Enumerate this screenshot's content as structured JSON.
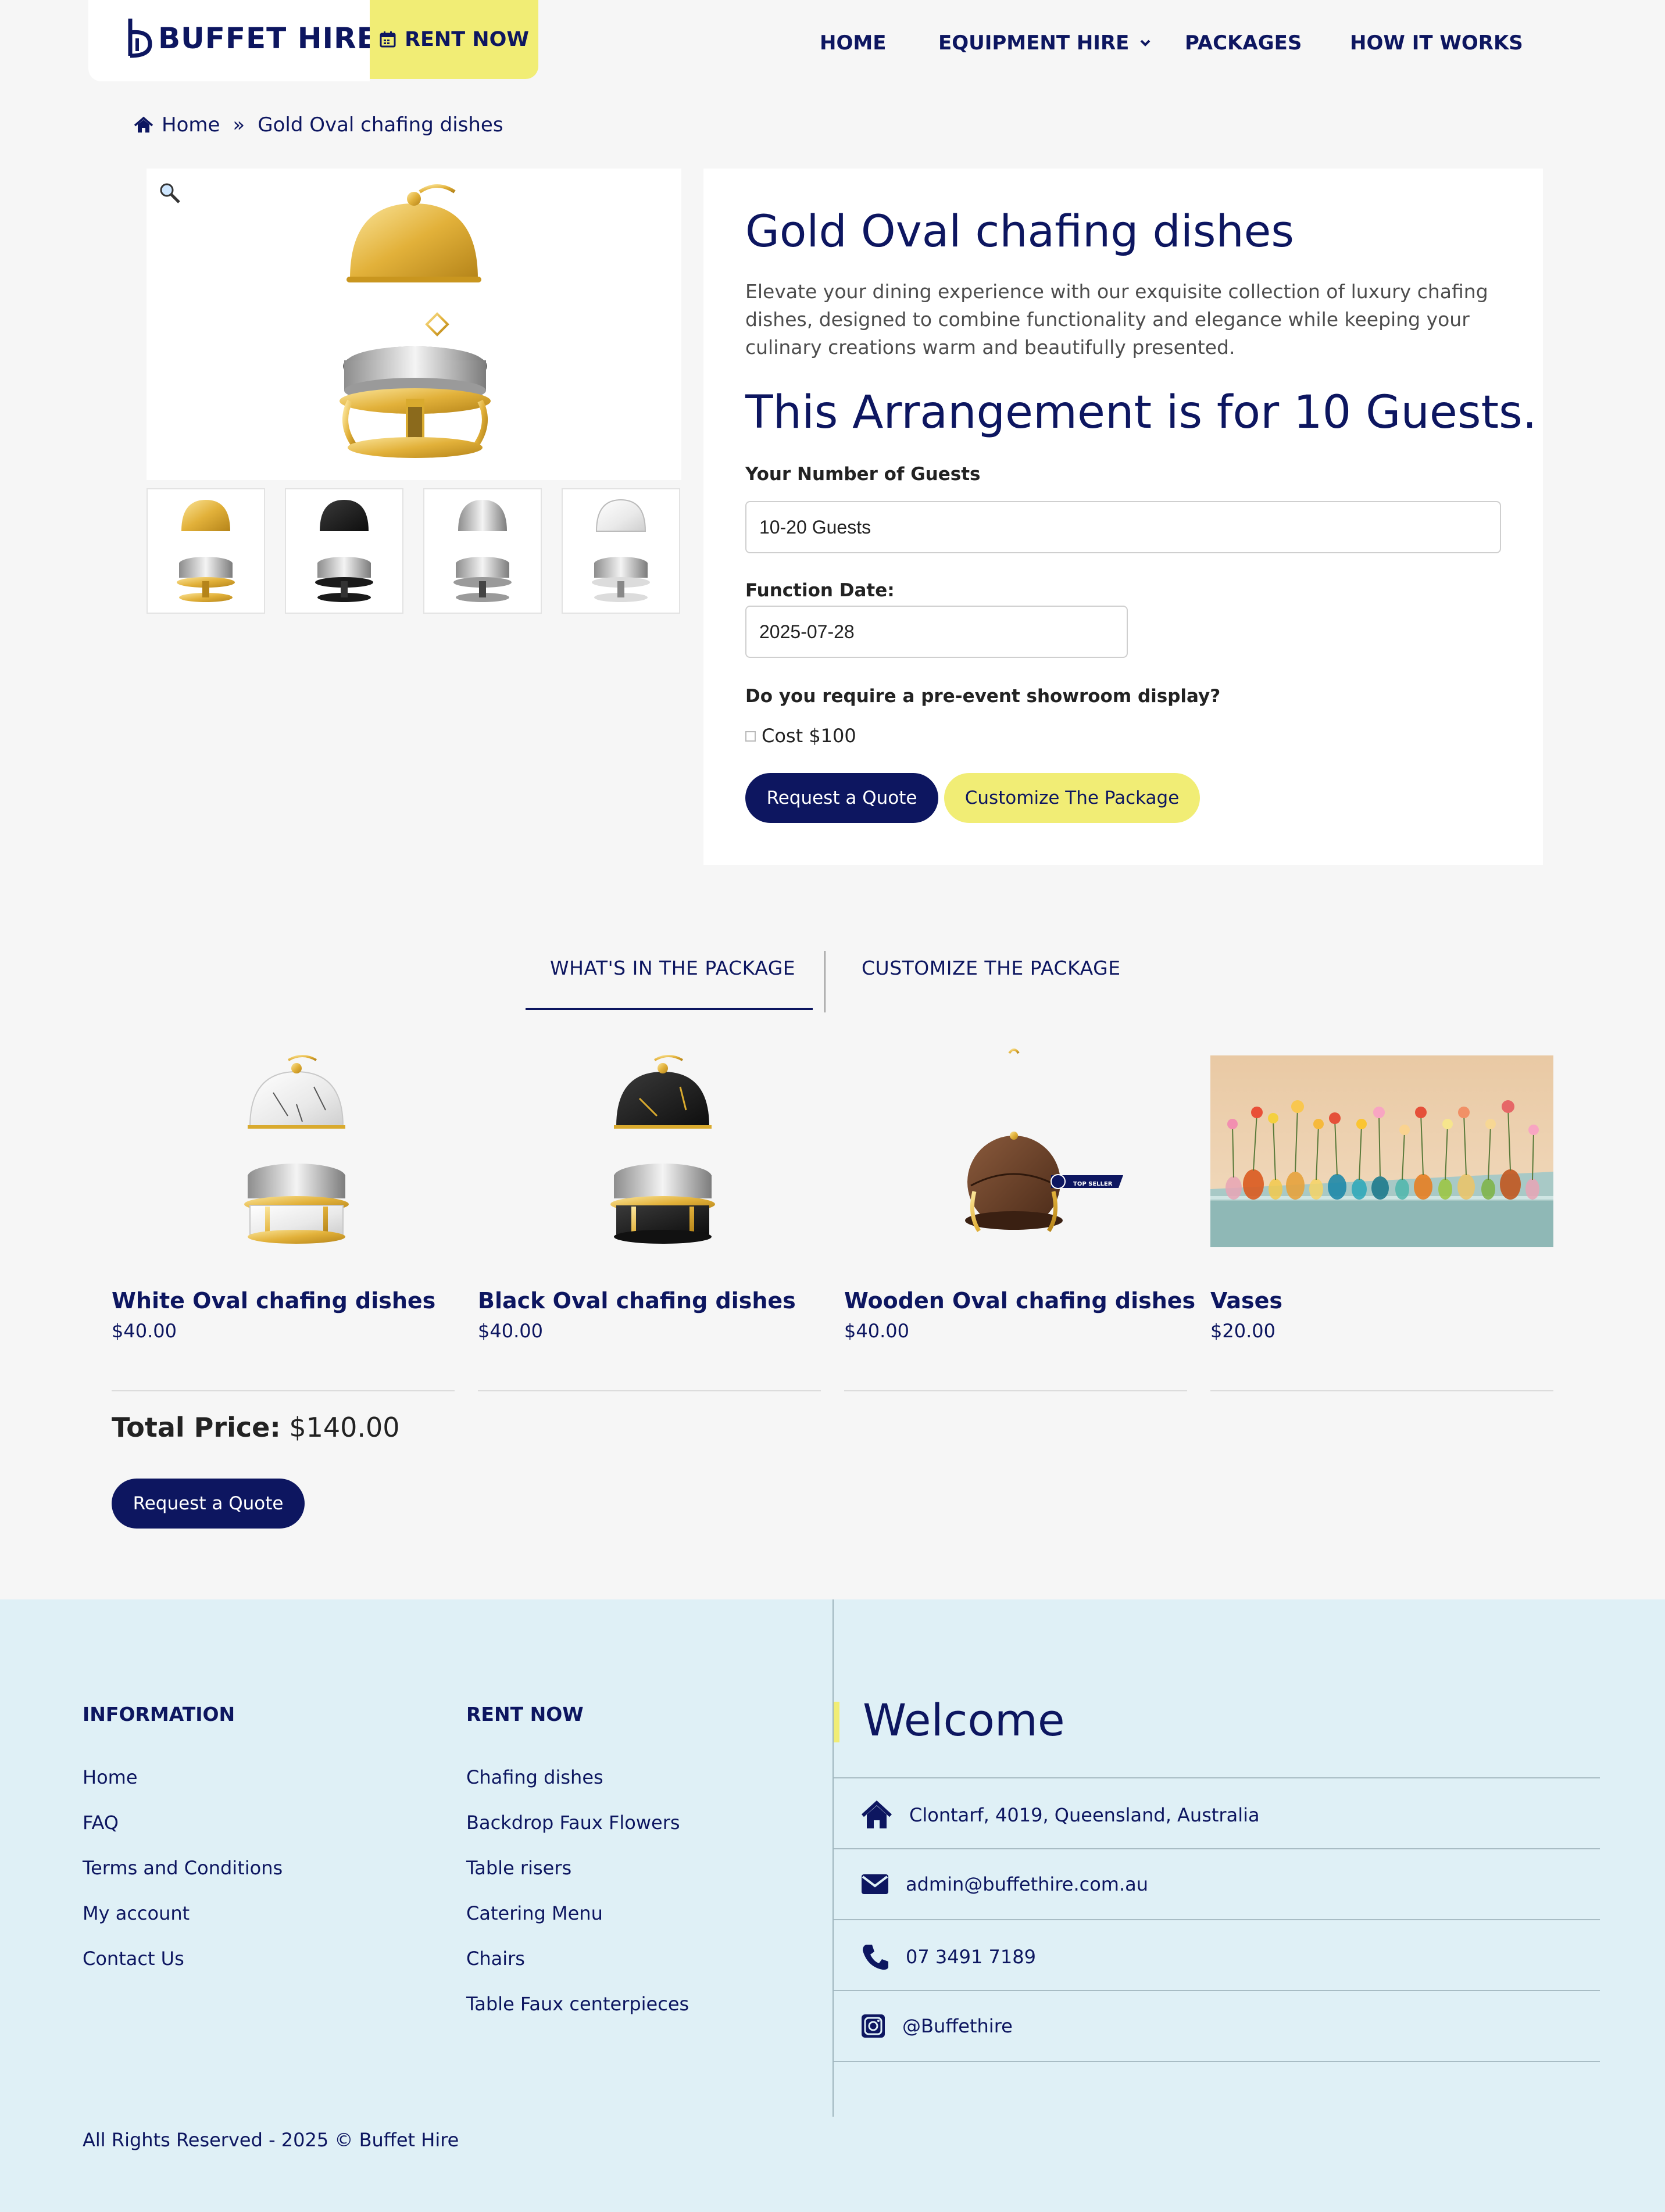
{
  "header": {
    "logo_text": "BUFFET HIRE",
    "rent_now_label": "RENT NOW",
    "nav": [
      "HOME",
      "EQUIPMENT HIRE",
      "PACKAGES",
      "HOW IT WORKS"
    ]
  },
  "breadcrumb": {
    "home": "Home",
    "separator": "»",
    "current": "Gold Oval chafing dishes"
  },
  "product": {
    "title": "Gold Oval chafing dishes",
    "description": "Elevate your dining experience with our exquisite collection of luxury chafing dishes, designed to combine functionality and elegance while keeping your culinary creations warm and beautifully presented.",
    "arrangement_heading": "This Arrangement is for 10 Guests.",
    "guests_label": "Your Number of Guests",
    "guests_value": "10-20 Guests",
    "date_label": "Function Date:",
    "date_value": "2025-07-28",
    "showroom_label": "Do you require a pre-event showroom display?",
    "showroom_cost": "Cost $100",
    "request_quote": "Request a Quote",
    "customize": "Customize The Package"
  },
  "tabs": [
    "WHAT'S IN THE PACKAGE",
    "CUSTOMIZE THE PACKAGE"
  ],
  "package_items": [
    {
      "name": "White Oval chafing dishes",
      "price": "$40.00"
    },
    {
      "name": "Black Oval chafing dishes",
      "price": "$40.00"
    },
    {
      "name": "Wooden Oval chafing dishes",
      "price": "$40.00"
    },
    {
      "name": "Vases",
      "price": "$20.00"
    }
  ],
  "top_seller_badge": "TOP SELLER",
  "total": {
    "label": "Total Price:",
    "value": "$140.00"
  },
  "bottom_request_quote": "Request a Quote",
  "footer": {
    "information_heading": "INFORMATION",
    "information_links": [
      "Home",
      "FAQ",
      "Terms and Conditions",
      "My account",
      "Contact Us"
    ],
    "rent_heading": "RENT NOW",
    "rent_links": [
      "Chafing dishes",
      "Backdrop Faux Flowers",
      "Table risers",
      "Catering Menu",
      "Chairs",
      "Table Faux centerpieces"
    ],
    "welcome": "Welcome",
    "address": "Clontarf, 4019, Queensland, Australia",
    "email": "admin@buffethire.com.au",
    "phone": "07 3491 7189",
    "instagram": "@Buffethire",
    "copyright": "All Rights Reserved - 2025 © Buffet Hire"
  },
  "colors": {
    "navy": "#0d1660",
    "yellow": "#f1ed75",
    "page_bg": "#f6f6f6",
    "footer_bg": "#dff0f6",
    "gold": "#d9aa2e"
  }
}
